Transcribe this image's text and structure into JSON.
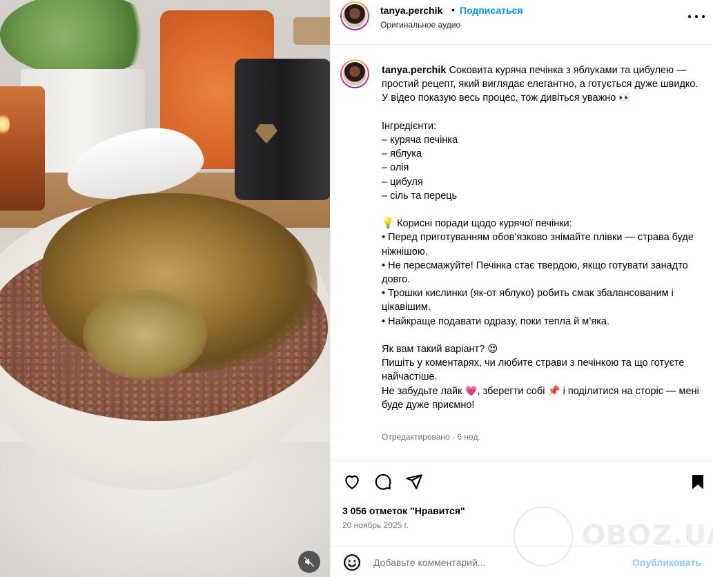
{
  "post": {
    "username": "tanya.perchik",
    "separator": "•",
    "follow_label": "Подписаться",
    "audio_label": "Оригинальное аудио",
    "caption_user": "tanya.perchik",
    "caption_body": " Соковита куряча печінка з яблуками та цибулею — простий рецепт, який виглядає елегантно, а готується дуже швидко.\nУ відео показую весь процес, тож дивіться уважно 👀\n\nІнгредієнти:\n– куряча печінка\n– яблука\n– олія\n– цибуля\n– сіль та перець\n\n💡 Корисні поради щодо курячої печінки:\n• Перед приготуванням обов’язково знімайте плівки — страва буде ніжнішою.\n• Не пересмажуйте! Печінка стає твердою, якщо готувати занадто довго.\n• Трошки кислинки (як-от яблуко) робить смак збалансованим і цікавішим.\n• Найкраще подавати одразу, поки тепла й м’яка.\n\nЯк вам такий варіант? 😍\nПишіть у коментарях, чи любите страви з печінкою та що готуєте найчастіше.\nНе забудьте лайк 💗, зберегти собі 📌 і поділитися на сторіс — мені буде дуже приємно!",
    "edited_label": "Отредактировано · 6 нед.",
    "likes_label": "3 056 отметок \"Нравится\"",
    "date_label": "20 ноябрь 2025 г.",
    "comment_placeholder": "Добавьте комментарий...",
    "publish_label": "Опубликовать"
  },
  "watermark": {
    "text": "OBOZ.UA"
  },
  "icons": {
    "like": "heart-icon",
    "comment": "comment-icon",
    "share": "send-icon",
    "save": "bookmark-icon",
    "emoji": "emoji-icon",
    "mute": "muted-speaker-icon",
    "more": "more-dots-icon"
  },
  "colors": {
    "follow": "#0095f6",
    "publish": "#8cc9fb",
    "muted_text": "#737373"
  }
}
